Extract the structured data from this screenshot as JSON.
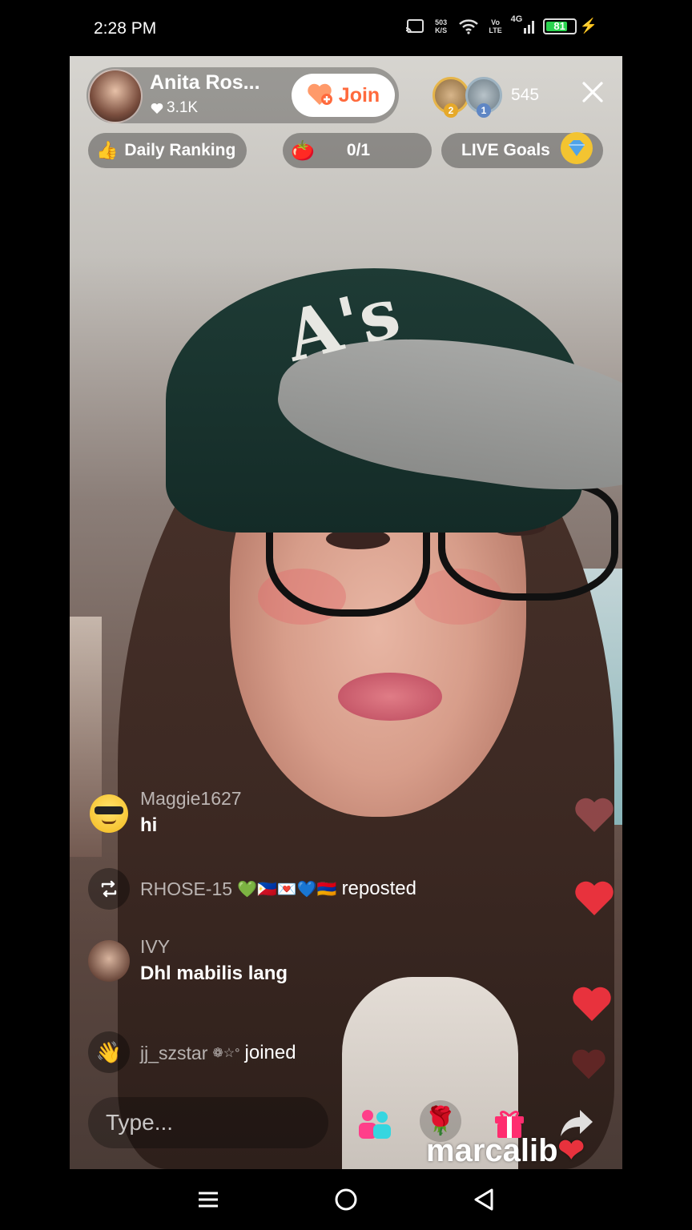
{
  "status_bar": {
    "time": "2:28 PM",
    "net_speed_top": "503",
    "net_speed_bottom": "K/S",
    "volte_top": "Vo",
    "volte_bottom": "LTE",
    "network": "4G",
    "battery": "81",
    "icons": [
      "cast-icon",
      "wifi-icon",
      "signal-icon",
      "battery-icon",
      "charging-icon"
    ]
  },
  "host": {
    "name": "Anita Ros...",
    "likes": "3.1K",
    "join_label": "Join"
  },
  "viewers": {
    "rank1": "2",
    "rank2": "1",
    "count": "545"
  },
  "chips": {
    "daily_ranking": "Daily Ranking",
    "goal_count": "0/1",
    "live_goals": "LIVE Goals"
  },
  "video": {
    "cap_logo": "A's"
  },
  "chat": [
    {
      "name": "Maggie1627",
      "message": "hi"
    },
    {
      "name": "RHOSE-15",
      "flags": "💚🇵🇭💌💙🇦🇲",
      "action": "reposted"
    },
    {
      "name": "IVY",
      "message": "Dhl mabilis lang"
    },
    {
      "name": "jj_szstar",
      "suffix": "❁☆°",
      "action": "joined"
    }
  ],
  "input": {
    "placeholder": "Type..."
  },
  "watermark": "marcalib",
  "colors": {
    "join_text": "#ff6a3d",
    "like_heart": "#e83a3a",
    "status_green": "#2bd34f"
  }
}
